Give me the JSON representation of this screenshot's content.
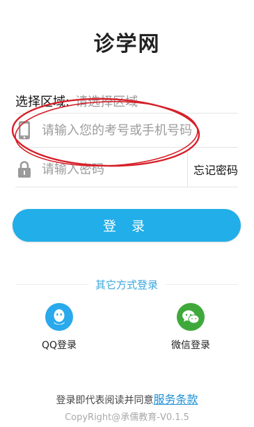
{
  "app": {
    "title": "诊学网"
  },
  "form": {
    "region_label": "选择区域:",
    "region_placeholder": "请选择区域",
    "account_placeholder": "请输入您的考号或手机号码",
    "password_placeholder": "请输入密码",
    "forgot_password": "忘记密码"
  },
  "login_button": "登 录",
  "other_methods": {
    "heading": "其它方式登录",
    "qq": {
      "label": "QQ登录",
      "icon": "qq-icon"
    },
    "wechat": {
      "label": "微信登录",
      "icon": "wechat-icon"
    }
  },
  "footer": {
    "agreement_prefix": "登录即代表阅读并同意",
    "agreement_link": "服务条款",
    "copyright": "CopyRight@承儒教育-V0.1.5"
  },
  "colors": {
    "accent": "#22aee8",
    "link": "#1a8fd6",
    "qq": "#2aa9ec",
    "wechat": "#3ea93a",
    "annotation": "#d6202a"
  }
}
